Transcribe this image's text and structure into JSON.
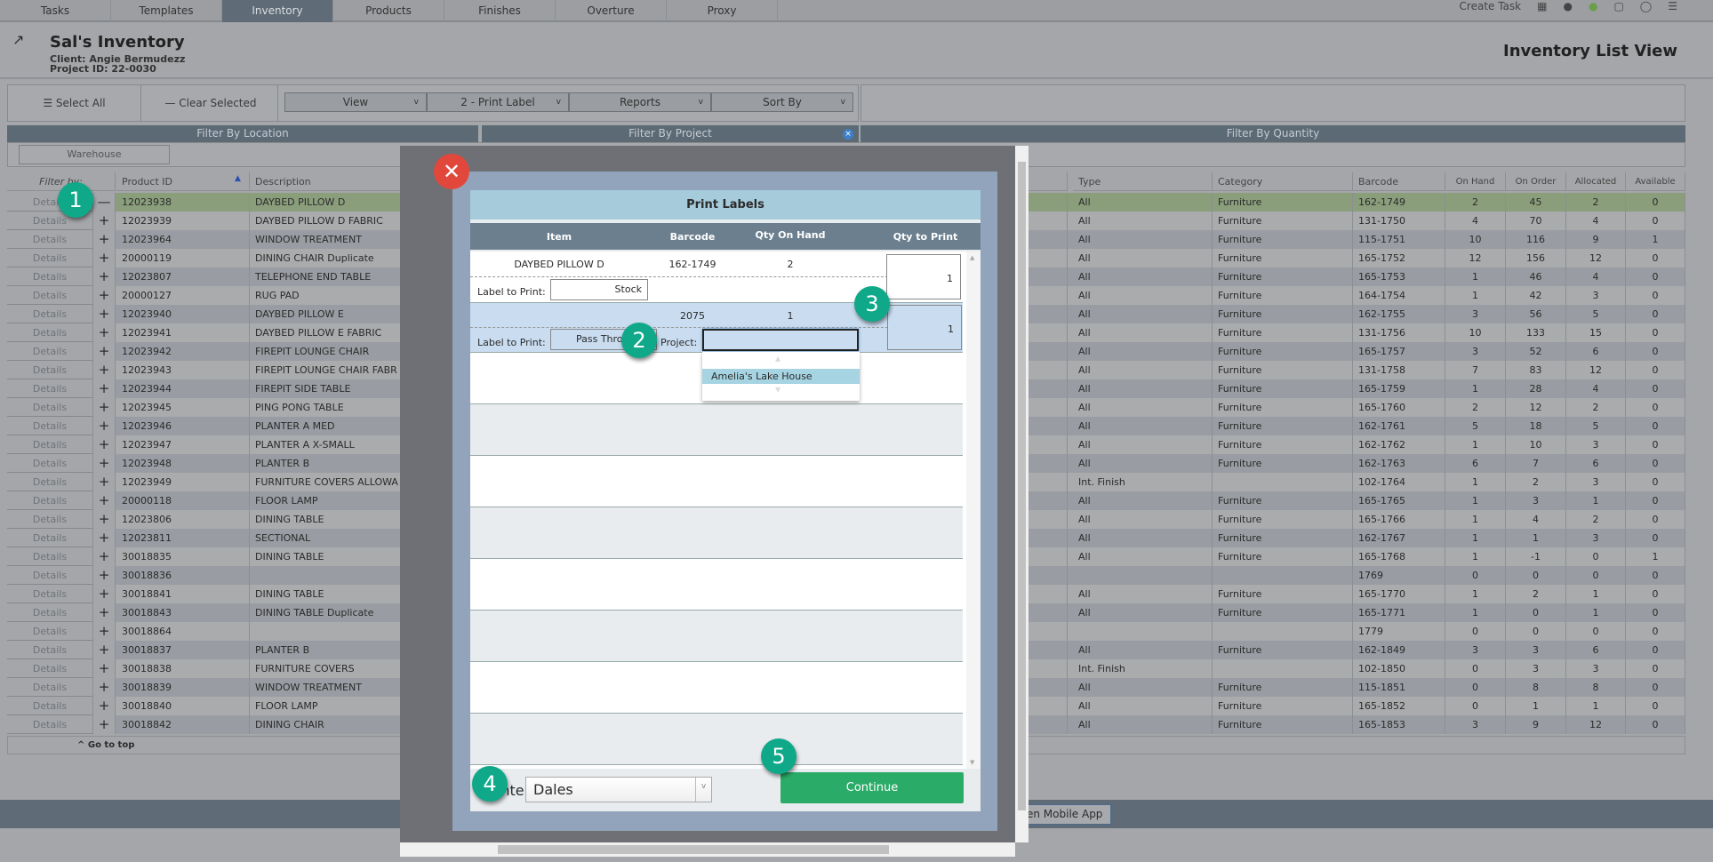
{
  "nav": {
    "tabs": [
      "Tasks",
      "Templates",
      "Inventory",
      "Products",
      "Finishes",
      "Overture",
      "Proxy"
    ],
    "active": "Inventory",
    "create_task": "Create Task"
  },
  "header": {
    "title": "Sal's Inventory",
    "client": "Client: Angie Bermudezz",
    "project_id": "Project ID: 22-0030",
    "view_title": "Inventory List View"
  },
  "toolbar": {
    "select_all": "Select All",
    "clear_selected": "Clear Selected",
    "view": "View",
    "print_label": "2 - Print Label",
    "reports": "Reports",
    "sort_by": "Sort By"
  },
  "filters": {
    "location": "Filter By Location",
    "project": "Filter By Project",
    "quantity": "Filter By Quantity",
    "warehouse": "Warehouse"
  },
  "table": {
    "filter_by": "Filter by:",
    "details": "Details",
    "columns": [
      "Product ID",
      "Description",
      "Type",
      "Category",
      "Barcode",
      "On Hand",
      "On Order",
      "Allocated",
      "Available"
    ],
    "rows": [
      [
        "12023938",
        "DAYBED PILLOW D",
        "All",
        "Furniture",
        "162-1749",
        "2",
        "45",
        "2",
        "0"
      ],
      [
        "12023939",
        "DAYBED PILLOW D FABRIC",
        "All",
        "Furniture",
        "131-1750",
        "4",
        "70",
        "4",
        "0"
      ],
      [
        "12023964",
        "WINDOW TREATMENT",
        "All",
        "Furniture",
        "115-1751",
        "10",
        "116",
        "9",
        "1"
      ],
      [
        "20000119",
        "DINING CHAIR Duplicate",
        "All",
        "Furniture",
        "165-1752",
        "12",
        "156",
        "12",
        "0"
      ],
      [
        "12023807",
        "TELEPHONE END TABLE",
        "All",
        "Furniture",
        "165-1753",
        "1",
        "46",
        "4",
        "0"
      ],
      [
        "20000127",
        "RUG PAD",
        "All",
        "Furniture",
        "164-1754",
        "1",
        "42",
        "3",
        "0"
      ],
      [
        "12023940",
        "DAYBED PILLOW E",
        "All",
        "Furniture",
        "162-1755",
        "3",
        "56",
        "5",
        "0"
      ],
      [
        "12023941",
        "DAYBED PILLOW E FABRIC",
        "All",
        "Furniture",
        "131-1756",
        "10",
        "133",
        "15",
        "0"
      ],
      [
        "12023942",
        "FIREPIT LOUNGE CHAIR",
        "All",
        "Furniture",
        "165-1757",
        "3",
        "52",
        "6",
        "0"
      ],
      [
        "12023943",
        "FIREPIT LOUNGE CHAIR FABR",
        "All",
        "Furniture",
        "131-1758",
        "7",
        "83",
        "12",
        "0"
      ],
      [
        "12023944",
        "FIREPIT SIDE TABLE",
        "All",
        "Furniture",
        "165-1759",
        "1",
        "28",
        "4",
        "0"
      ],
      [
        "12023945",
        "PING PONG TABLE",
        "All",
        "Furniture",
        "165-1760",
        "2",
        "12",
        "2",
        "0"
      ],
      [
        "12023946",
        "PLANTER A MED",
        "All",
        "Furniture",
        "162-1761",
        "5",
        "18",
        "5",
        "0"
      ],
      [
        "12023947",
        "PLANTER A X-SMALL",
        "All",
        "Furniture",
        "162-1762",
        "1",
        "10",
        "3",
        "0"
      ],
      [
        "12023948",
        "PLANTER B",
        "All",
        "Furniture",
        "162-1763",
        "6",
        "7",
        "6",
        "0"
      ],
      [
        "12023949",
        "FURNITURE COVERS ALLOWA",
        "Int. Finish",
        "",
        "102-1764",
        "1",
        "2",
        "3",
        "0"
      ],
      [
        "20000118",
        "FLOOR LAMP",
        "All",
        "Furniture",
        "165-1765",
        "1",
        "3",
        "1",
        "0"
      ],
      [
        "12023806",
        "DINING TABLE",
        "All",
        "Furniture",
        "165-1766",
        "1",
        "4",
        "2",
        "0"
      ],
      [
        "12023811",
        "SECTIONAL",
        "All",
        "Furniture",
        "162-1767",
        "1",
        "1",
        "3",
        "0"
      ],
      [
        "30018835",
        "DINING TABLE",
        "All",
        "Furniture",
        "165-1768",
        "1",
        "-1",
        "0",
        "1"
      ],
      [
        "30018836",
        "",
        "",
        "",
        "1769",
        "0",
        "0",
        "0",
        "0"
      ],
      [
        "30018841",
        "DINING TABLE",
        "All",
        "Furniture",
        "165-1770",
        "1",
        "2",
        "1",
        "0"
      ],
      [
        "30018843",
        "DINING TABLE Duplicate",
        "All",
        "Furniture",
        "165-1771",
        "1",
        "0",
        "1",
        "0"
      ],
      [
        "30018864",
        "",
        "",
        "",
        "1779",
        "0",
        "0",
        "0",
        "0"
      ],
      [
        "30018837",
        "PLANTER B",
        "All",
        "Furniture",
        "162-1849",
        "3",
        "3",
        "6",
        "0"
      ],
      [
        "30018838",
        "FURNITURE COVERS",
        "Int. Finish",
        "",
        "102-1850",
        "0",
        "3",
        "3",
        "0"
      ],
      [
        "30018839",
        "WINDOW TREATMENT",
        "All",
        "Furniture",
        "115-1851",
        "0",
        "8",
        "8",
        "0"
      ],
      [
        "30018840",
        "FLOOR LAMP",
        "All",
        "Furniture",
        "165-1852",
        "0",
        "1",
        "1",
        "0"
      ],
      [
        "30018842",
        "DINING CHAIR",
        "All",
        "Furniture",
        "165-1853",
        "3",
        "9",
        "12",
        "0"
      ]
    ],
    "go_to_top": "^ Go to top"
  },
  "footer": {
    "mobile_app": "en Mobile App"
  },
  "modal": {
    "title": "Print Labels",
    "columns": [
      "Item",
      "Barcode",
      "Qty On Hand",
      "Qty to Print"
    ],
    "items": [
      {
        "item": "DAYBED PILLOW D",
        "barcode": "162-1749",
        "qty_on_hand": "2",
        "label_caption": "Label to Print:",
        "label": "Stock",
        "qty_to_print": "1"
      },
      {
        "item": "",
        "barcode": "2075",
        "qty_on_hand": "1",
        "label_caption": "Label to Print:",
        "label": "Pass Thro",
        "project_caption": "Project:",
        "project_value": "",
        "qty_to_print": "1"
      }
    ],
    "project_options": [
      "Amelia's Lake House"
    ],
    "printer_label": "Printer:",
    "printer": "Dales",
    "continue": "Continue"
  },
  "badges": [
    "1",
    "2",
    "3",
    "4",
    "5"
  ],
  "colors": {
    "badge": "#0fa98a",
    "continue": "#2bab68",
    "close": "#e2473c",
    "selected_row": "#8a9e7c"
  }
}
